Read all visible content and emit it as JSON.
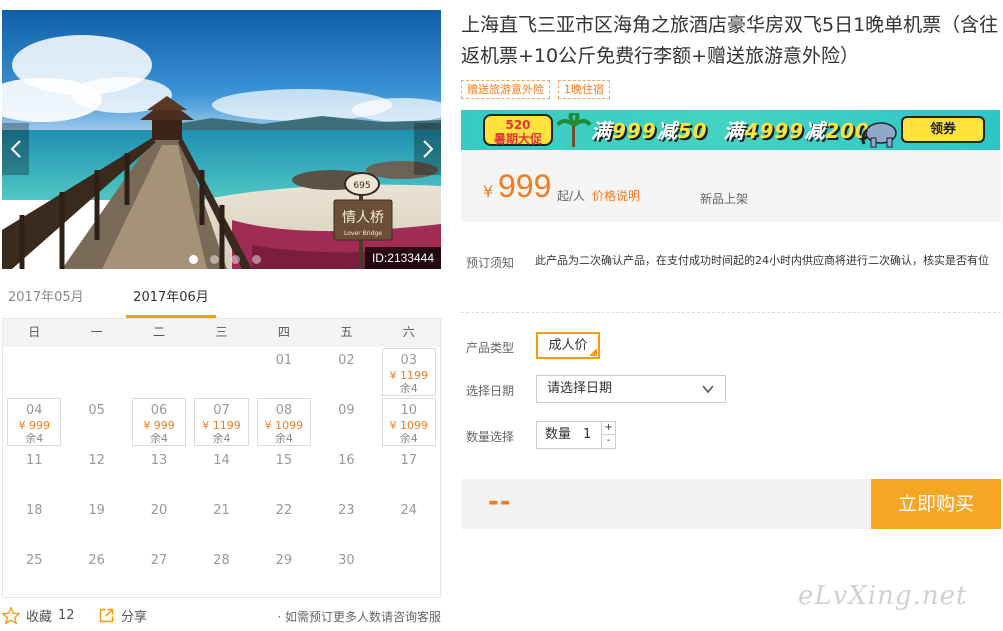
{
  "photo": {
    "id_label": "ID:2133444",
    "sign_text": "情人桥",
    "sign_subtext": "Lover Bridge",
    "sign_number": "695",
    "dots": 4,
    "active_dot": 0
  },
  "calendar": {
    "months": [
      "2017年05月",
      "2017年06月"
    ],
    "active_month_index": 1,
    "weekdays": [
      "日",
      "一",
      "二",
      "三",
      "四",
      "五",
      "六"
    ],
    "leading_blank": 4,
    "days": [
      {
        "d": "01"
      },
      {
        "d": "02"
      },
      {
        "d": "03",
        "price": "¥ 1199",
        "stock": "余4"
      },
      {
        "d": "04",
        "price": "¥ 999",
        "stock": "余4"
      },
      {
        "d": "05"
      },
      {
        "d": "06",
        "price": "¥ 999",
        "stock": "余4"
      },
      {
        "d": "07",
        "price": "¥ 1199",
        "stock": "余4"
      },
      {
        "d": "08",
        "price": "¥ 1099",
        "stock": "余4"
      },
      {
        "d": "09"
      },
      {
        "d": "10",
        "price": "¥ 1099",
        "stock": "余4"
      },
      {
        "d": "11"
      },
      {
        "d": "12"
      },
      {
        "d": "13"
      },
      {
        "d": "14"
      },
      {
        "d": "15"
      },
      {
        "d": "16"
      },
      {
        "d": "17"
      },
      {
        "d": "18"
      },
      {
        "d": "19"
      },
      {
        "d": "20"
      },
      {
        "d": "21"
      },
      {
        "d": "22"
      },
      {
        "d": "23"
      },
      {
        "d": "24"
      },
      {
        "d": "25"
      },
      {
        "d": "26"
      },
      {
        "d": "27"
      },
      {
        "d": "28"
      },
      {
        "d": "29"
      },
      {
        "d": "30"
      }
    ]
  },
  "footer": {
    "fav_label": "收藏",
    "fav_count": "12",
    "share_label": "分享",
    "consult_text": "· 如需预订更多人数请咨询客服"
  },
  "product": {
    "title": "上海直飞三亚市区海角之旅酒店豪华房双飞5日1晚单机票（含往返机票+10公斤免费行李额+赠送旅游意外险）",
    "tags": [
      "赠送旅游意外险",
      "1晚住宿"
    ]
  },
  "banner": {
    "badge_line1": "520",
    "badge_line2": "暑期大促",
    "offer1_prefix": "满",
    "offer1_amount": "999",
    "offer1_mid": "减",
    "offer1_discount": "50",
    "offer2_prefix": "满",
    "offer2_amount": "4999",
    "offer2_mid": "减",
    "offer2_discount": "200",
    "coupon_label": "领券"
  },
  "price": {
    "currency": "¥",
    "value": "999",
    "unit": "起/人",
    "explain_link": "价格说明",
    "new_label": "新品上架"
  },
  "booking": {
    "notice_label": "预订须知",
    "notice_text": "此产品为二次确认产品，在支付成功时间起的24小时内供应商将进行二次确认，核实是否有位",
    "type_label": "产品类型",
    "type_option": "成人价",
    "date_label": "选择日期",
    "date_placeholder": "请选择日期",
    "qty_label": "数量选择",
    "qty_field_label": "数量",
    "qty_value": "1",
    "plus": "+",
    "minus": "-"
  },
  "buy": {
    "total": "--",
    "button_label": "立即购买"
  },
  "watermark": "eLvXing.net",
  "colors": {
    "accent": "#f37b1d",
    "buy_button": "#f5a623",
    "banner_bg": "#3fcfc4"
  }
}
